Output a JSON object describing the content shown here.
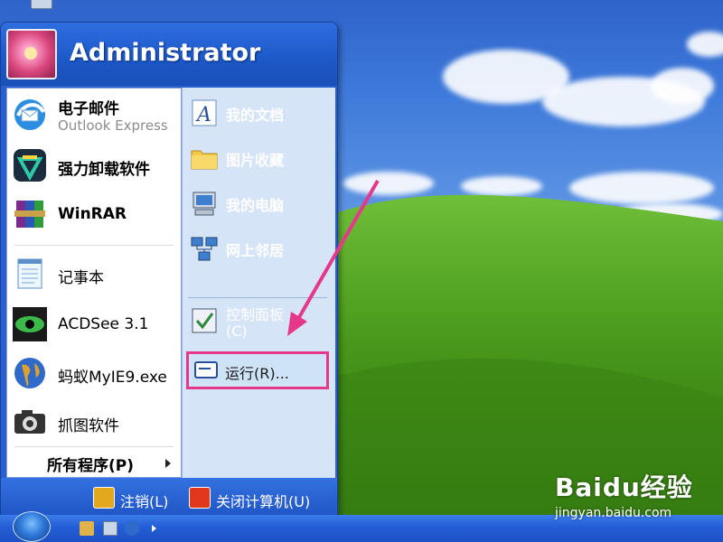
{
  "user": {
    "name": "Administrator"
  },
  "left_pane": {
    "pinned": [
      {
        "label": "电子邮件",
        "sub": "Outlook Express",
        "icon": "outlook-express-icon"
      },
      {
        "label": "强力卸载软件",
        "icon": "uninstaller-icon"
      },
      {
        "label": "WinRAR",
        "icon": "winrar-icon"
      }
    ],
    "recent": [
      {
        "label": "记事本",
        "icon": "notepad-icon"
      },
      {
        "label": "ACDSee 3.1",
        "icon": "acdsee-icon"
      },
      {
        "label": "蚂蚁MyIE9.exe",
        "icon": "globe-icon"
      },
      {
        "label": "抓图软件",
        "icon": "camera-icon"
      }
    ],
    "all_programs": "所有程序(P)"
  },
  "right_pane": {
    "items": [
      {
        "label": "我的文档",
        "icon": "documents-icon"
      },
      {
        "label": "图片收藏",
        "icon": "folder-icon"
      },
      {
        "label": "我的电脑",
        "icon": "computer-icon"
      },
      {
        "label": "网上邻居",
        "icon": "network-icon"
      }
    ],
    "control_panel": {
      "line1": "控制面板",
      "line2": "(C)",
      "icon": "control-panel-icon"
    },
    "run": {
      "label": "运行(R)...",
      "icon": "run-icon"
    }
  },
  "footer": {
    "logoff": "注销(L)",
    "shutdown": "关闭计算机(U)"
  },
  "watermark": {
    "brand": "Baidu经验",
    "url": "jingyan.baidu.com"
  },
  "colors": {
    "menu_blue": "#2a5fcf",
    "highlight_border": "#e6388b",
    "annotation_arrow": "#e6388b"
  }
}
